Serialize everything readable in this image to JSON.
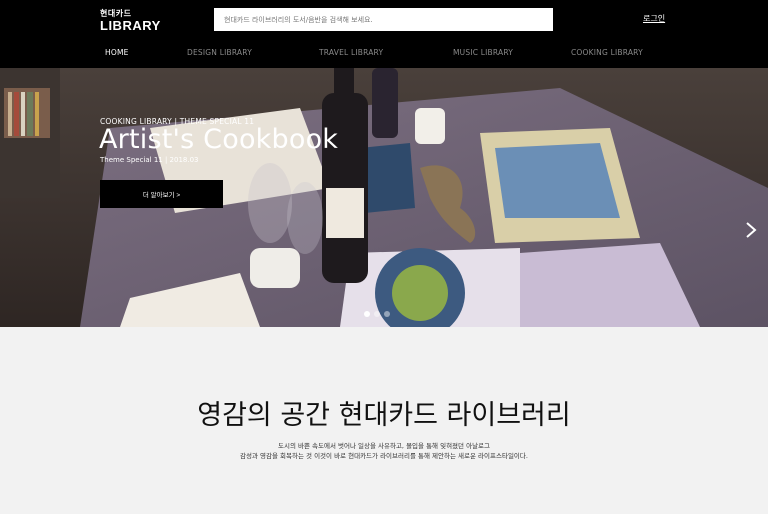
{
  "header": {
    "logo_small": "현대카드",
    "logo_big": "LIBRARY",
    "search_placeholder": "현대카드 라이브러리의 도서/음반을 검색해 보세요.",
    "login_label": "로그인"
  },
  "nav": {
    "items": [
      {
        "label": "HOME",
        "active": true
      },
      {
        "label": "DESIGN LIBRARY",
        "active": false
      },
      {
        "label": "TRAVEL LIBRARY",
        "active": false
      },
      {
        "label": "MUSIC LIBRARY",
        "active": false
      },
      {
        "label": "COOKING LIBRARY",
        "active": false
      }
    ]
  },
  "hero": {
    "category": "COOKING LIBRARY | THEME SPECIAL 11",
    "title": "Artist's Cookbook",
    "subtitle": "Theme Special 11 | 2018.03",
    "button_label": "더 알아보기 >",
    "slides": 3,
    "active_slide": 1,
    "next_icon": "chevron-right-icon"
  },
  "intro": {
    "title": "영감의 공간 현대카드 라이브러리",
    "line1": "도시의 바쁜 속도에서 벗어나 일상을 사유하고, 몰입을 통해 잊혀졌던 아날로그",
    "line2": "감성과 영감을 회복하는 것 이것이 바로 현대카드가 라이브러리를 통해 제안하는 새로운 라이프스타일이다."
  },
  "colors": {
    "header_bg": "#000000",
    "nav_active": "#ffffff",
    "nav_inactive": "#8a8a8a",
    "page_bg": "#f2f2f2"
  }
}
